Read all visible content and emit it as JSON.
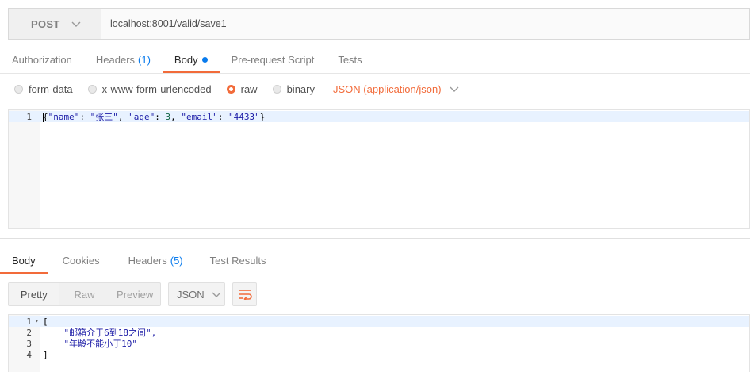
{
  "request": {
    "method": "POST",
    "url": "localhost:8001/valid/save1"
  },
  "request_tabs": [
    {
      "label": "Authorization"
    },
    {
      "label": "Headers",
      "count": "(1)"
    },
    {
      "label": "Body",
      "active": true
    },
    {
      "label": "Pre-request Script"
    },
    {
      "label": "Tests"
    }
  ],
  "body_types": {
    "form_data": "form-data",
    "urlencoded": "x-www-form-urlencoded",
    "raw": "raw",
    "binary": "binary",
    "selected": "raw",
    "content_type": "JSON (application/json)"
  },
  "request_body": {
    "line_numbers": [
      "1"
    ],
    "text": "{\"name\": \"张三\", \"age\": 3, \"email\": \"4433\"}",
    "parts": {
      "open": "{",
      "k1": "\"name\"",
      "c1": ": ",
      "v1": "\"张三\"",
      "s1": ", ",
      "k2": "\"age\"",
      "c2": ": ",
      "v2": "3",
      "s2": ", ",
      "k3": "\"email\"",
      "c3": ": ",
      "v3": "\"4433\"",
      "close": "}"
    }
  },
  "response_tabs": [
    {
      "label": "Body",
      "active": true
    },
    {
      "label": "Cookies"
    },
    {
      "label": "Headers",
      "count": "(5)"
    },
    {
      "label": "Test Results"
    }
  ],
  "response_toolbar": {
    "views": [
      "Pretty",
      "Raw",
      "Preview"
    ],
    "active_view": "Pretty",
    "format": "JSON"
  },
  "response_body": {
    "line_numbers": [
      "1",
      "2",
      "3",
      "4"
    ],
    "lines": [
      "[",
      "    \"邮箱介于6到18之间\",",
      "    \"年龄不能小于10\"",
      "]"
    ]
  },
  "colors": {
    "accent": "#f26b3a",
    "link_blue": "#097bed"
  }
}
